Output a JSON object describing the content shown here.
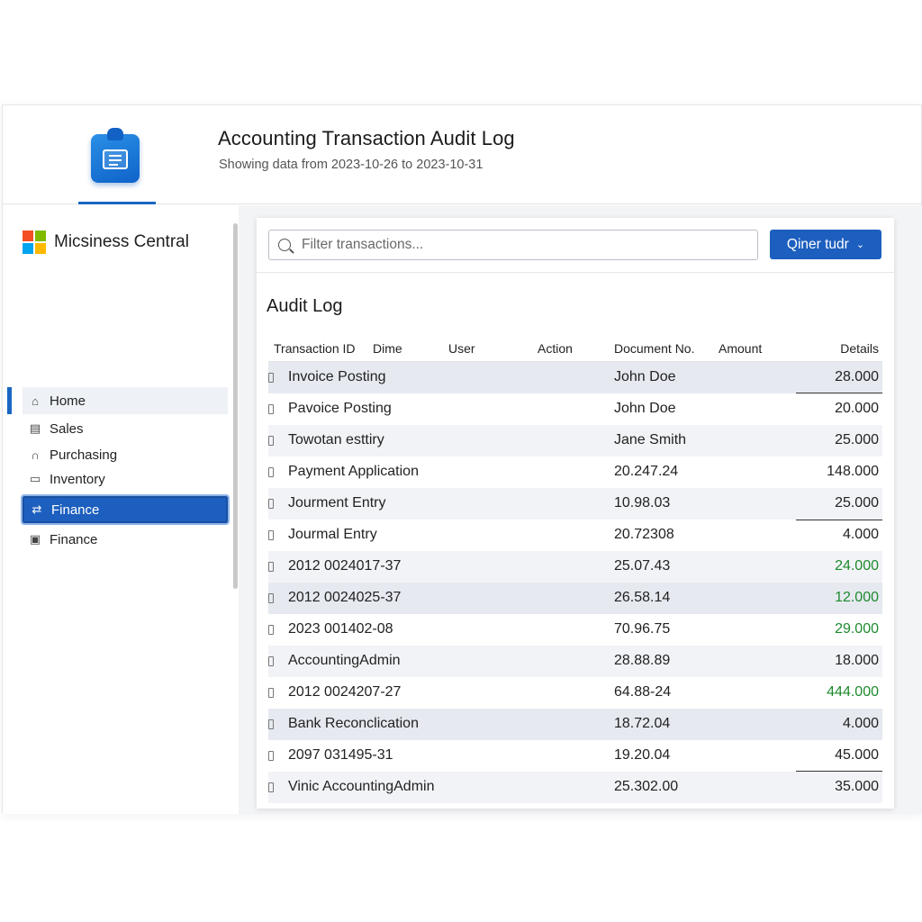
{
  "header": {
    "title": "Accounting Transaction Audit Log",
    "subtitle": "Showing data from 2023-10-26 to 2023-10-31",
    "app_icon": "clipboard-icon"
  },
  "sidebar": {
    "brand": "Micsiness Central",
    "items": [
      {
        "label": "Home",
        "icon": "home-icon"
      },
      {
        "label": "Sales",
        "icon": "sales-icon"
      },
      {
        "label": "Purchasing",
        "icon": "purchasing-icon"
      },
      {
        "label": "Inventory",
        "icon": "folder-icon"
      },
      {
        "label": "Finance",
        "icon": "finance-icon",
        "active": true
      },
      {
        "label": "Finance",
        "icon": "document-icon"
      }
    ]
  },
  "main": {
    "search_placeholder": "Filter transactions...",
    "query_button": "Qiner tudr",
    "section_title": "Audit Log",
    "columns": [
      "Transaction ID",
      "Dime",
      "User",
      "Action",
      "Document No.",
      "Amount",
      "Details"
    ],
    "rows": [
      {
        "c1": "Invoice Posting",
        "c2": "John Doe",
        "c3": "28.000"
      },
      {
        "c1": "Pavoice Posting",
        "c2": "John Doe",
        "c3": "20.000"
      },
      {
        "c1": "Towotan esttiry",
        "c2": "Jane Smith",
        "c3": "25.000"
      },
      {
        "c1": "Payment Application",
        "c2": "20.247.24",
        "c3": "148.000"
      },
      {
        "c1": "Jourment Entry",
        "c2": "10.98.03",
        "c3": "25.000"
      },
      {
        "c1": "Jourmal Entry",
        "c2": "20.72308",
        "c3": "4.000"
      },
      {
        "c1": "2012 0024017-37",
        "c2": "25.07.43",
        "c3": "24.000"
      },
      {
        "c1": "2012 0024025-37",
        "c2": "26.58.14",
        "c3": "12.000"
      },
      {
        "c1": "2023 001402-08",
        "c2": "70.96.75",
        "c3": "29.000"
      },
      {
        "c1": "AccountingAdmin",
        "c2": "28.88.89",
        "c3": "18.000"
      },
      {
        "c1": "2012 0024207-27",
        "c2": "64.88-24",
        "c3": "444.000"
      },
      {
        "c1": "Bank Reconclication",
        "c2": "18.72.04",
        "c3": "4.000"
      },
      {
        "c1": "2097 031495-31",
        "c2": "19.20.04",
        "c3": "45.000"
      },
      {
        "c1": "Vinic AccountingAdmin",
        "c2": "25.302.00",
        "c3": "35.000"
      }
    ]
  },
  "colors": {
    "accent": "#1d5fbf",
    "positive": "#1d8a2e"
  }
}
